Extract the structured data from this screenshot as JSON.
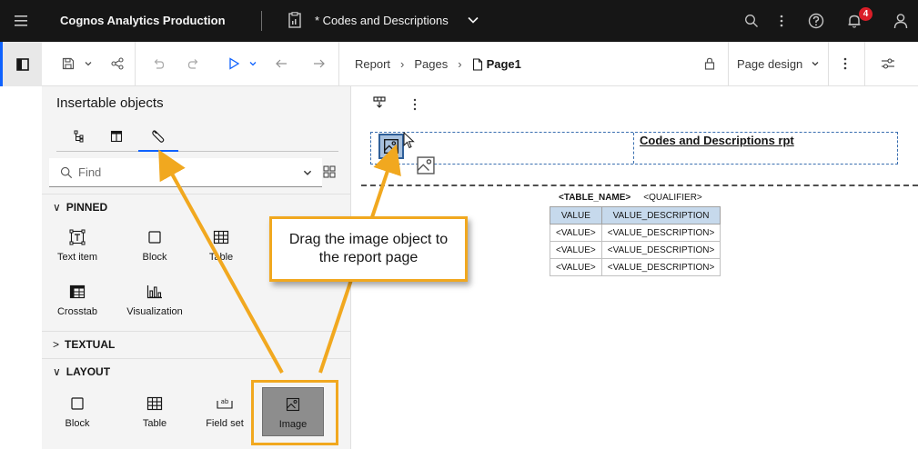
{
  "header": {
    "product": "Cognos Analytics Production",
    "doc_title": "* Codes and Descriptions",
    "notification_count": "4"
  },
  "toolbar": {
    "breadcrumb": [
      "Report",
      "Pages",
      "Page1"
    ],
    "page_design": "Page design"
  },
  "panel": {
    "title": "Insertable objects",
    "search_placeholder": "Find",
    "sections": {
      "pinned": "PINNED",
      "textual": "TEXTUAL",
      "layout": "LAYOUT"
    },
    "pinned_items": [
      {
        "label": "Text item",
        "icon": "text-item-icon"
      },
      {
        "label": "Block",
        "icon": "block-icon"
      },
      {
        "label": "Table",
        "icon": "table-icon"
      },
      {
        "label": "Crosstab",
        "icon": "crosstab-icon"
      },
      {
        "label": "Visualization",
        "icon": "visualization-icon"
      }
    ],
    "layout_items": [
      {
        "label": "Block",
        "icon": "block-icon"
      },
      {
        "label": "Table",
        "icon": "table-icon"
      },
      {
        "label": "Field set",
        "icon": "field-set-icon"
      },
      {
        "label": "Image",
        "icon": "image-icon",
        "selected": true
      }
    ]
  },
  "canvas": {
    "report_title": "Codes and Descriptions rpt",
    "table_caption": {
      "name": "<TABLE_NAME>",
      "qualifier": "<QUALIFIER>"
    },
    "table_headers": [
      "VALUE",
      "VALUE_DESCRIPTION"
    ],
    "table_rows": [
      [
        "<VALUE>",
        "<VALUE_DESCRIPTION>"
      ],
      [
        "<VALUE>",
        "<VALUE_DESCRIPTION>"
      ],
      [
        "<VALUE>",
        "<VALUE_DESCRIPTION>"
      ]
    ]
  },
  "callout": {
    "text": "Drag the image object to the report page"
  },
  "colors": {
    "header_bg": "#161616",
    "accent": "#0f62fe",
    "callout_border": "#f1a81f",
    "notification": "#da1e28"
  }
}
